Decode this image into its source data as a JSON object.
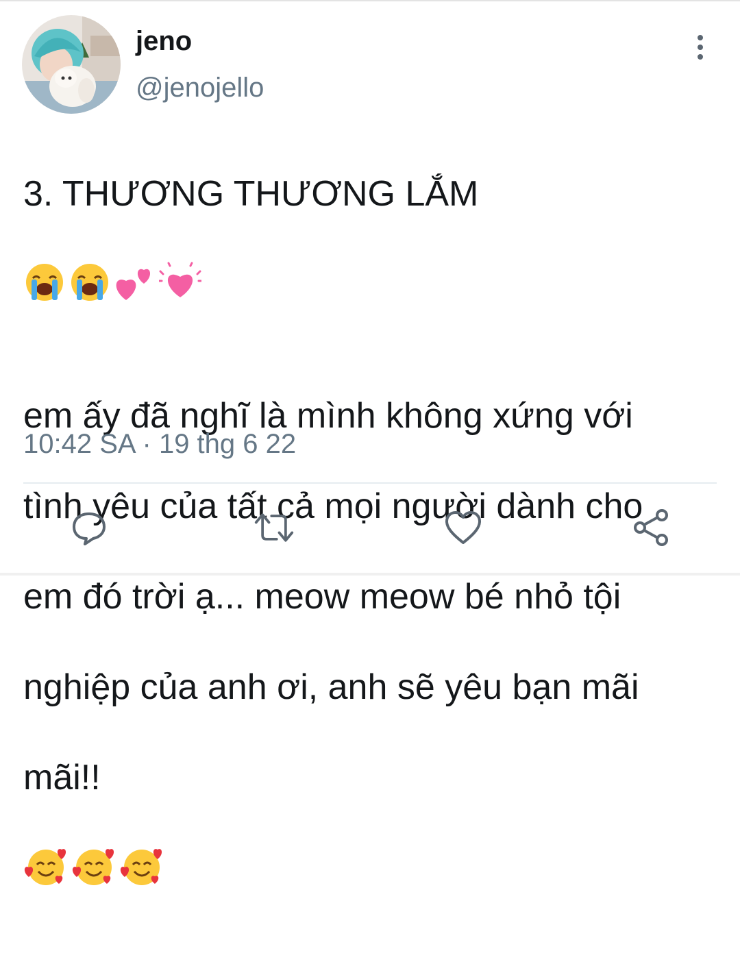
{
  "author": {
    "display_name": "jeno",
    "handle": "@jenojello",
    "avatar_icon": "profile-photo"
  },
  "tweet": {
    "lines": [
      "3. THƯƠNG THƯƠNG LẮM",
      "em ấy đã nghĩ là mình không xứng với",
      "tình yêu của tất cả mọi người dành cho",
      "em đó trời ạ... meow meow bé nhỏ tội",
      "nghiệp của anh ơi, anh sẽ yêu bạn mãi",
      "mãi!!"
    ],
    "emojis_line1": [
      "loudly-crying-face",
      "loudly-crying-face",
      "two-hearts",
      "beating-heart"
    ],
    "emojis_last": [
      "smiling-face-with-hearts",
      "smiling-face-with-hearts",
      "smiling-face-with-hearts"
    ]
  },
  "meta": {
    "time": "10:42 SA",
    "dot": "·",
    "date": "19 thg 6 22"
  },
  "actions": {
    "reply_icon": "reply-icon",
    "retweet_icon": "retweet-icon",
    "like_icon": "like-icon",
    "share_icon": "share-icon"
  },
  "colors": {
    "text": "#14171a",
    "secondary": "#657786",
    "icon": "#5b6671",
    "divider": "#e6ecf0"
  }
}
